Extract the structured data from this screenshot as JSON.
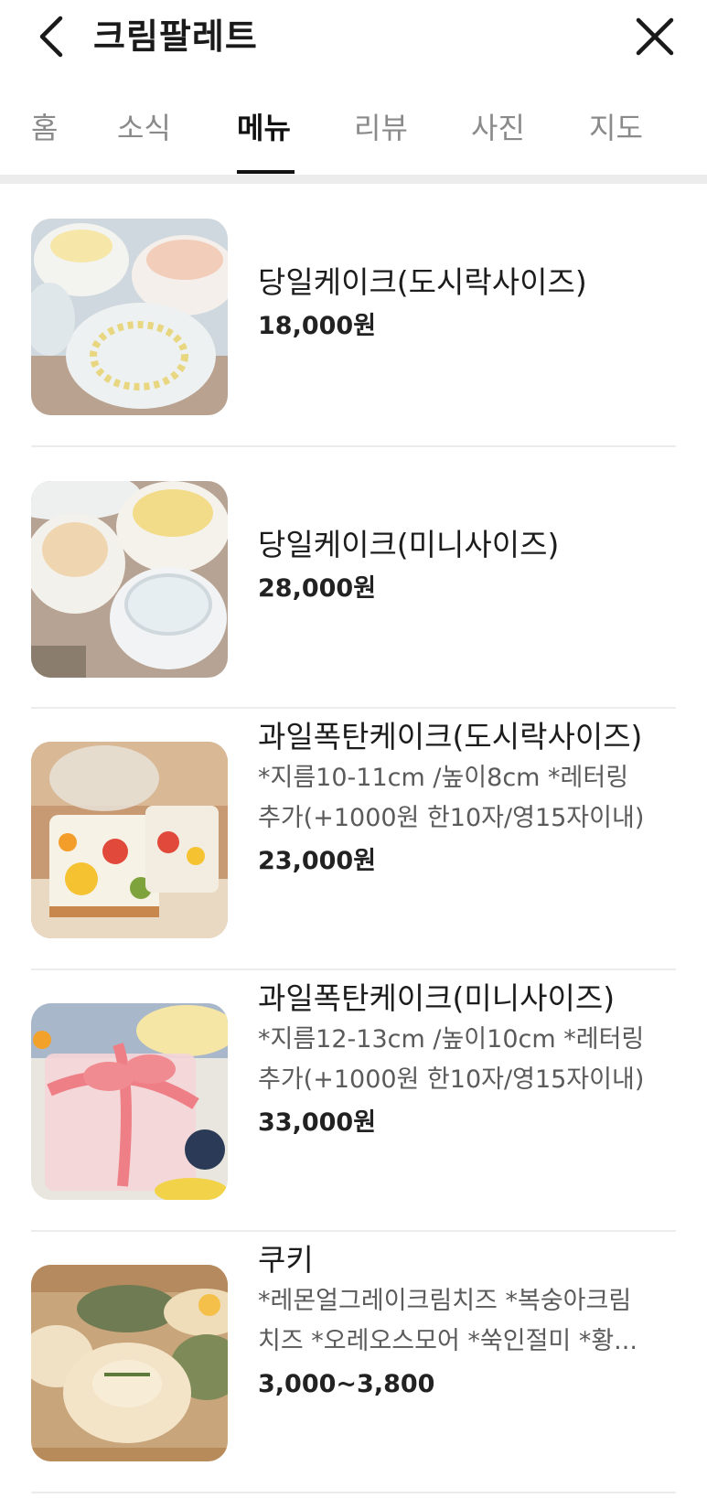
{
  "header": {
    "title": "크림팔레트",
    "back_icon": "chevron-left-icon",
    "close_icon": "close-icon"
  },
  "tabs": [
    {
      "label": "홈",
      "active": false
    },
    {
      "label": "소식",
      "active": false
    },
    {
      "label": "메뉴",
      "active": true
    },
    {
      "label": "리뷰",
      "active": false
    },
    {
      "label": "사진",
      "active": false
    },
    {
      "label": "지도",
      "active": false
    }
  ],
  "menu": {
    "items": [
      {
        "name": "당일케이크(도시락사이즈)",
        "desc_lines": [],
        "price": "18,000원",
        "image": "cake-lunchbox-photo"
      },
      {
        "name": "당일케이크(미니사이즈)",
        "desc_lines": [],
        "price": "28,000원",
        "image": "cake-mini-photo"
      },
      {
        "name": "과일폭탄케이크(도시락사이즈)",
        "desc_lines": [
          "*지름10-11cm /높이8cm *레터링",
          "추가(+1000원 한10자/영15자이내)"
        ],
        "price": "23,000원",
        "image": "fruit-cake-lunchbox-photo"
      },
      {
        "name": "과일폭탄케이크(미니사이즈)",
        "desc_lines": [
          "*지름12-13cm /높이10cm *레터링",
          "추가(+1000원 한10자/영15자이내)"
        ],
        "price": "33,000원",
        "image": "fruit-cake-mini-photo"
      },
      {
        "name": "쿠키",
        "desc_lines": [
          "*레몬얼그레이크림치즈 *복숭아크림",
          "치즈 *오레오스모어 *쑥인절미 *황..."
        ],
        "price": "3,000~3,800",
        "image": "cookie-photo"
      }
    ]
  }
}
